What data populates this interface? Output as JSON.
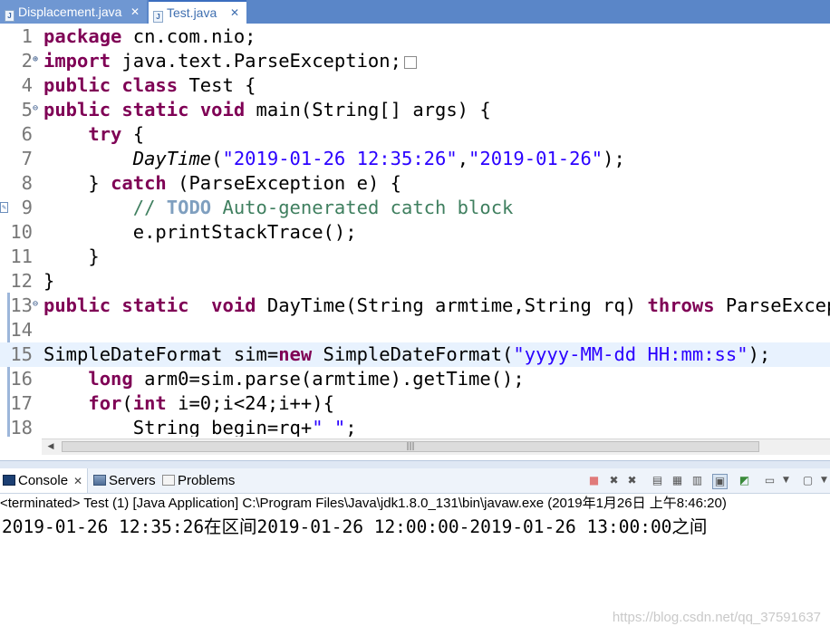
{
  "tabs": [
    {
      "label": "Displacement.java",
      "active": false,
      "close": "✕"
    },
    {
      "label": "Test.java",
      "active": true,
      "close": "✕"
    }
  ],
  "editor": {
    "lines": [
      {
        "num": "1",
        "tokens": [
          {
            "t": "package",
            "c": "kw"
          },
          {
            "t": " cn.com.nio;"
          }
        ]
      },
      {
        "num": "2",
        "fold": "plus",
        "tokens": [
          {
            "t": "import",
            "c": "kw"
          },
          {
            "t": " java.text.ParseException;"
          }
        ],
        "folded_box": true
      },
      {
        "num": "4",
        "tokens": [
          {
            "t": "public",
            "c": "kw"
          },
          {
            "t": " "
          },
          {
            "t": "class",
            "c": "kw"
          },
          {
            "t": " Test {"
          }
        ]
      },
      {
        "num": "5",
        "fold": "minus",
        "tokens": [
          {
            "t": "public",
            "c": "kw"
          },
          {
            "t": " "
          },
          {
            "t": "static",
            "c": "kw"
          },
          {
            "t": " "
          },
          {
            "t": "void",
            "c": "kw"
          },
          {
            "t": " main(String[] args) {"
          }
        ]
      },
      {
        "num": "6",
        "tokens": [
          {
            "t": "    "
          },
          {
            "t": "try",
            "c": "kw"
          },
          {
            "t": " {"
          }
        ]
      },
      {
        "num": "7",
        "tokens": [
          {
            "t": "        "
          },
          {
            "t": "DayTime",
            "c": "it"
          },
          {
            "t": "("
          },
          {
            "t": "\"2019-01-26 12:35:26\"",
            "c": "str"
          },
          {
            "t": ","
          },
          {
            "t": "\"2019-01-26\"",
            "c": "str"
          },
          {
            "t": ");"
          }
        ]
      },
      {
        "num": "8",
        "tokens": [
          {
            "t": "    } "
          },
          {
            "t": "catch",
            "c": "kw"
          },
          {
            "t": " (ParseException e) {"
          }
        ]
      },
      {
        "num": "9",
        "marker": true,
        "tokens": [
          {
            "t": "        "
          },
          {
            "t": "// ",
            "c": "cm"
          },
          {
            "t": "TODO",
            "c": "todo"
          },
          {
            "t": " Auto-generated catch block",
            "c": "cm"
          }
        ]
      },
      {
        "num": "10",
        "tokens": [
          {
            "t": "        e.printStackTrace();"
          }
        ]
      },
      {
        "num": "11",
        "tokens": [
          {
            "t": "    }"
          }
        ]
      },
      {
        "num": "12",
        "tokens": [
          {
            "t": "}"
          }
        ]
      },
      {
        "num": "13",
        "fold": "minus",
        "tokens": [
          {
            "t": "public",
            "c": "kw"
          },
          {
            "t": " "
          },
          {
            "t": "static",
            "c": "kw"
          },
          {
            "t": "  "
          },
          {
            "t": "void",
            "c": "kw"
          },
          {
            "t": " DayTime(String armtime,String rq) "
          },
          {
            "t": "throws",
            "c": "kw"
          },
          {
            "t": " ParseException{"
          }
        ]
      },
      {
        "num": "14",
        "tokens": [
          {
            "t": ""
          }
        ]
      },
      {
        "num": "15",
        "highlight": true,
        "tokens": [
          {
            "t": "SimpleDateFormat sim="
          },
          {
            "t": "new",
            "c": "kw"
          },
          {
            "t": " SimpleDateFormat("
          },
          {
            "t": "\"yyyy-MM-dd HH:mm:ss\"",
            "c": "str"
          },
          {
            "t": ");"
          }
        ]
      },
      {
        "num": "16",
        "tokens": [
          {
            "t": "    "
          },
          {
            "t": "long",
            "c": "kw"
          },
          {
            "t": " arm0=sim.parse(armtime).getTime();"
          }
        ]
      },
      {
        "num": "17",
        "tokens": [
          {
            "t": "    "
          },
          {
            "t": "for",
            "c": "kw"
          },
          {
            "t": "("
          },
          {
            "t": "int",
            "c": "kw"
          },
          {
            "t": " i=0;i<24;i++){"
          }
        ]
      },
      {
        "num": "18",
        "tokens": [
          {
            "t": "        String begin=rq+"
          },
          {
            "t": "\" \"",
            "c": "str"
          },
          {
            "t": ";"
          }
        ]
      }
    ]
  },
  "hscroll": {
    "left_arrow": "◀",
    "grip": "|||"
  },
  "views": {
    "console_label": "Console",
    "console_close": "✕",
    "servers_label": "Servers",
    "problems_label": "Problems"
  },
  "console": {
    "terminated": "<terminated> Test (1) [Java Application] C:\\Program Files\\Java\\jdk1.8.0_131\\bin\\javaw.exe (2019年1月26日 上午8:46:20)",
    "output": "2019-01-26 12:35:26在区间2019-01-26 12:00:00-2019-01-26 13:00:00之间"
  },
  "watermark": "https://blog.csdn.net/qq_37591637",
  "colors": {
    "keyword": "#7f0055",
    "string": "#2a00ff",
    "comment": "#3f7f5f",
    "todo": "#7f9fbf",
    "tab_bar": "#5a86c8",
    "highlight_line": "#e8f2fe"
  }
}
